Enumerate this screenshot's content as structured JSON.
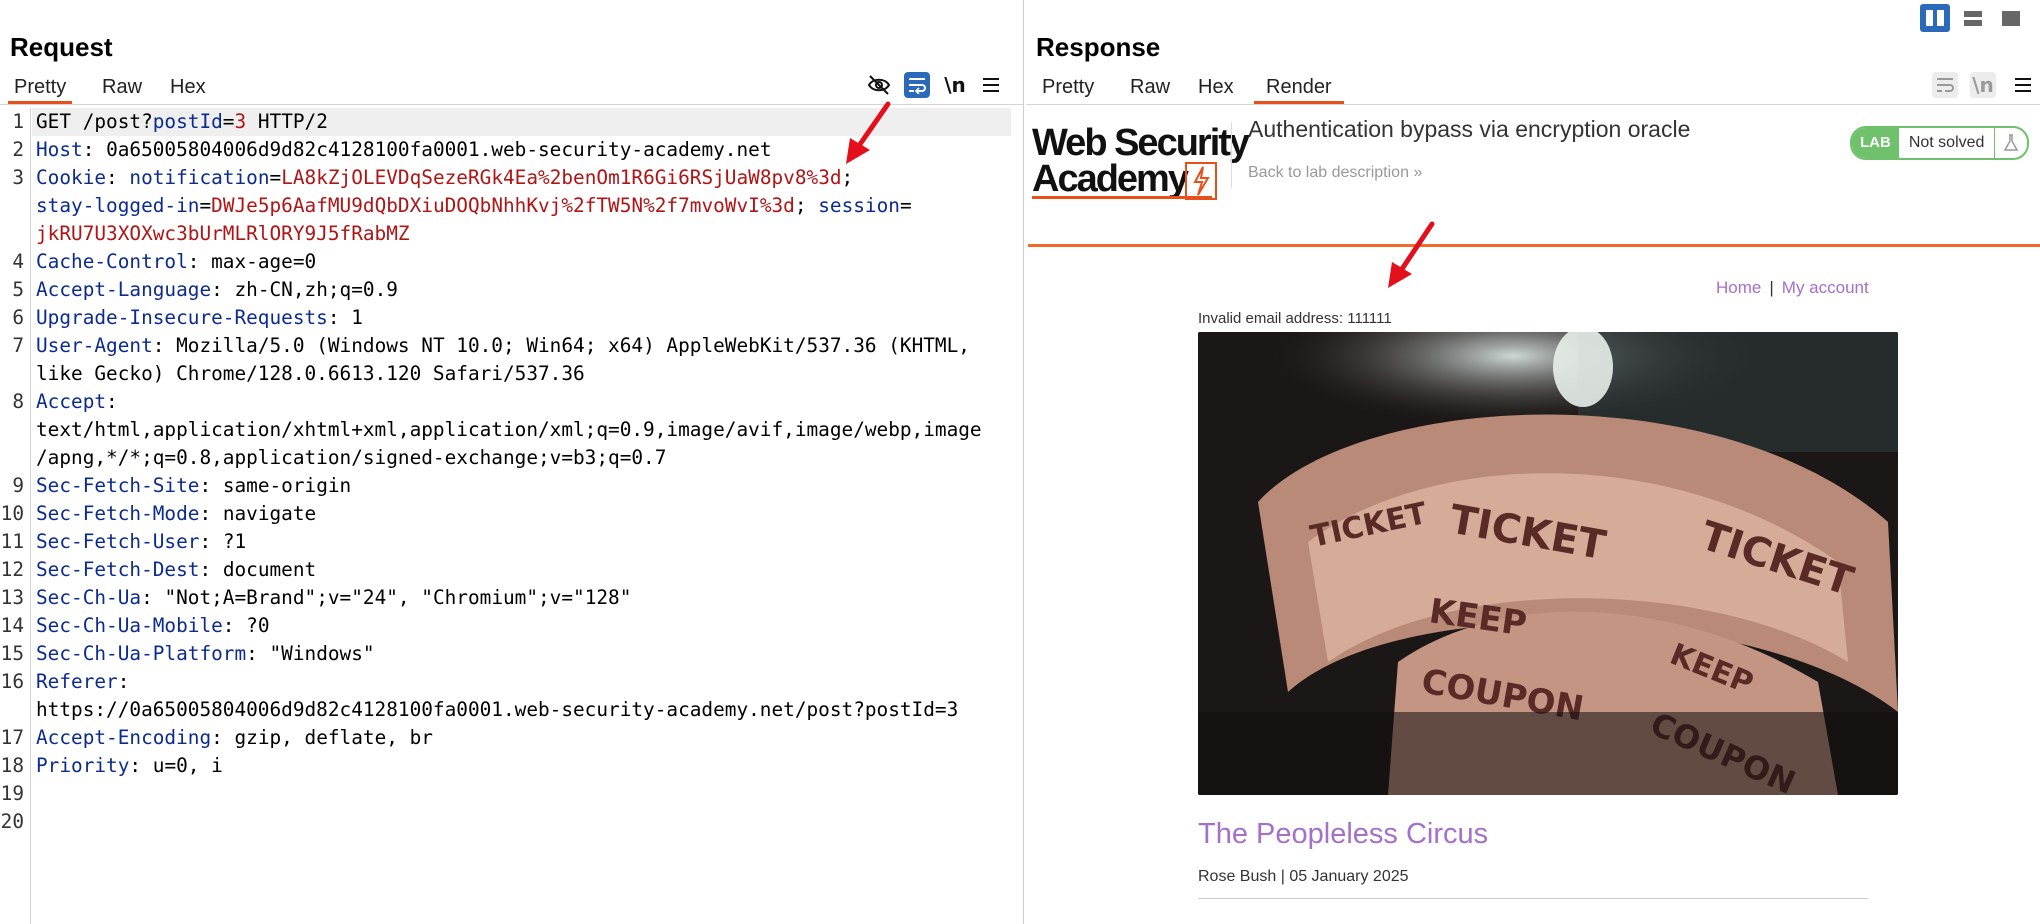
{
  "request": {
    "title": "Request",
    "tabs": [
      {
        "label": "Pretty",
        "active": true
      },
      {
        "label": "Raw",
        "active": false
      },
      {
        "label": "Hex",
        "active": false
      }
    ],
    "toolbar": {
      "newline_label": "\\n"
    },
    "line_numbers": [
      "1",
      "2",
      "3",
      "4",
      "5",
      "6",
      "7",
      "8",
      "9",
      "10",
      "11",
      "12",
      "13",
      "14",
      "15",
      "16",
      "17",
      "18",
      "19",
      "20"
    ],
    "lines": {
      "l1": {
        "method": "GET /post?",
        "param": "postId",
        "eq": "=",
        "val": "3",
        "rest": " HTTP/2"
      },
      "l2": {
        "key": "Host",
        "sep": ": ",
        "val": "0a65005804006d9d82c4128100fa0001.web-security-academy.net"
      },
      "l3": {
        "key": "Cookie",
        "sep": ": ",
        "c1k": "notification",
        "c1v": "LA8kZjOLEVDqSezeRGk4Ea%2benOm1R6Gi6RSjUaW8pv8%3d",
        "c2k": "stay-logged-in",
        "c2v": "DWJe5p6AafMU9dQbDXiuDOQbNhhKvj%2fTW5N%2f7mvoWvI%3d",
        "c3k": "session",
        "c3v": "jkRU7U3XOXwc3bUrMLRlORY9J5fRabMZ"
      },
      "l4": {
        "key": "Cache-Control",
        "sep": ": ",
        "val": "max-age=0"
      },
      "l5": {
        "key": "Accept-Language",
        "sep": ": ",
        "val": "zh-CN,zh;q=0.9"
      },
      "l6": {
        "key": "Upgrade-Insecure-Requests",
        "sep": ": ",
        "val": "1"
      },
      "l7": {
        "key": "User-Agent",
        "sep": ": ",
        "val": "Mozilla/5.0 (Windows NT 10.0; Win64; x64) AppleWebKit/537.36 (KHTML,",
        "val2": "like Gecko) Chrome/128.0.6613.120 Safari/537.36"
      },
      "l8": {
        "key": "Accept",
        "sep": ":",
        "val": "text/html,application/xhtml+xml,application/xml;q=0.9,image/avif,image/webp,image",
        "val2": "/apng,*/*;q=0.8,application/signed-exchange;v=b3;q=0.7"
      },
      "l9": {
        "key": "Sec-Fetch-Site",
        "sep": ": ",
        "val": "same-origin"
      },
      "l10": {
        "key": "Sec-Fetch-Mode",
        "sep": ": ",
        "val": "navigate"
      },
      "l11": {
        "key": "Sec-Fetch-User",
        "sep": ": ",
        "val": "?1"
      },
      "l12": {
        "key": "Sec-Fetch-Dest",
        "sep": ": ",
        "val": "document"
      },
      "l13": {
        "key": "Sec-Ch-Ua",
        "sep": ": ",
        "val": "\"Not;A=Brand\";v=\"24\", \"Chromium\";v=\"128\""
      },
      "l14": {
        "key": "Sec-Ch-Ua-Mobile",
        "sep": ": ",
        "val": "?0"
      },
      "l15": {
        "key": "Sec-Ch-Ua-Platform",
        "sep": ": ",
        "val": "\"Windows\""
      },
      "l16": {
        "key": "Referer",
        "sep": ":",
        "val": "https://0a65005804006d9d82c4128100fa0001.web-security-academy.net/post?postId=3"
      },
      "l17": {
        "key": "Accept-Encoding",
        "sep": ": ",
        "val": "gzip, deflate, br"
      },
      "l18": {
        "key": "Priority",
        "sep": ": ",
        "val": "u=0, i"
      }
    }
  },
  "response": {
    "title": "Response",
    "tabs": [
      {
        "label": "Pretty",
        "active": false
      },
      {
        "label": "Raw",
        "active": false
      },
      {
        "label": "Hex",
        "active": false
      },
      {
        "label": "Render",
        "active": true
      }
    ],
    "toolbar": {
      "newline_label": "\\n"
    },
    "render": {
      "logo_line1": "Web Security",
      "logo_line2": "Academy",
      "lab_title": "Authentication bypass via encryption oracle",
      "back_link": "Back to lab description",
      "back_chevron": "»",
      "lab_badge": "LAB",
      "lab_status": "Not solved",
      "nav_home": "Home",
      "nav_sep": "|",
      "nav_account": "My account",
      "invalid_msg": "Invalid email address: 111111",
      "post_title": "The Peopleless Circus",
      "byline": "Rose Bush | 05 January 2025"
    }
  },
  "colors": {
    "accent": "#e8501a",
    "header_key": "#0b2b8f",
    "header_value": "#b01414",
    "lab_green": "#70c16b",
    "link_purple": "#a470c9",
    "annotation_arrow": "#e3101b"
  }
}
